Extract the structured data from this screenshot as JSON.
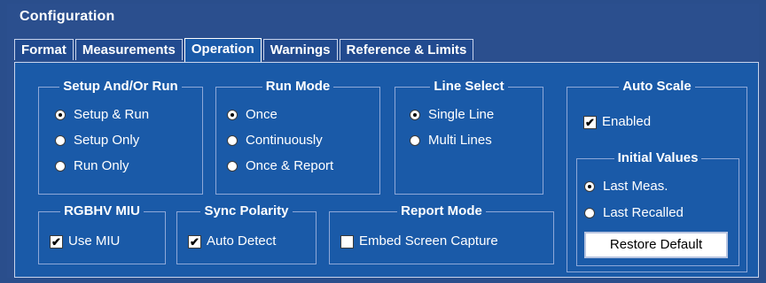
{
  "window": {
    "title": "Configuration"
  },
  "tabs": [
    {
      "label": "Format"
    },
    {
      "label": "Measurements"
    },
    {
      "label": "Operation",
      "active": true
    },
    {
      "label": "Warnings"
    },
    {
      "label": "Reference & Limits"
    }
  ],
  "setup_run": {
    "title": "Setup And/Or Run",
    "options": [
      "Setup & Run",
      "Setup Only",
      "Run Only"
    ],
    "selected": "Setup & Run"
  },
  "run_mode": {
    "title": "Run Mode",
    "options": [
      "Once",
      "Continuously",
      "Once & Report"
    ],
    "selected": "Once"
  },
  "line_select": {
    "title": "Line Select",
    "options": [
      "Single Line",
      "Multi Lines"
    ],
    "selected": "Single Line"
  },
  "auto_scale": {
    "title": "Auto Scale",
    "enabled_label": "Enabled",
    "enabled": true,
    "initial_values": {
      "title": "Initial Values",
      "options": [
        "Last Meas.",
        "Last Recalled"
      ],
      "selected": "Last Meas."
    },
    "restore_label": "Restore Default"
  },
  "rgbhv": {
    "title": "RGBHV MIU",
    "label": "Use MIU",
    "checked": true
  },
  "sync_polarity": {
    "title": "Sync Polarity",
    "label": "Auto Detect",
    "checked": true
  },
  "report_mode": {
    "title": "Report Mode",
    "label": "Embed Screen Capture",
    "checked": false
  }
}
